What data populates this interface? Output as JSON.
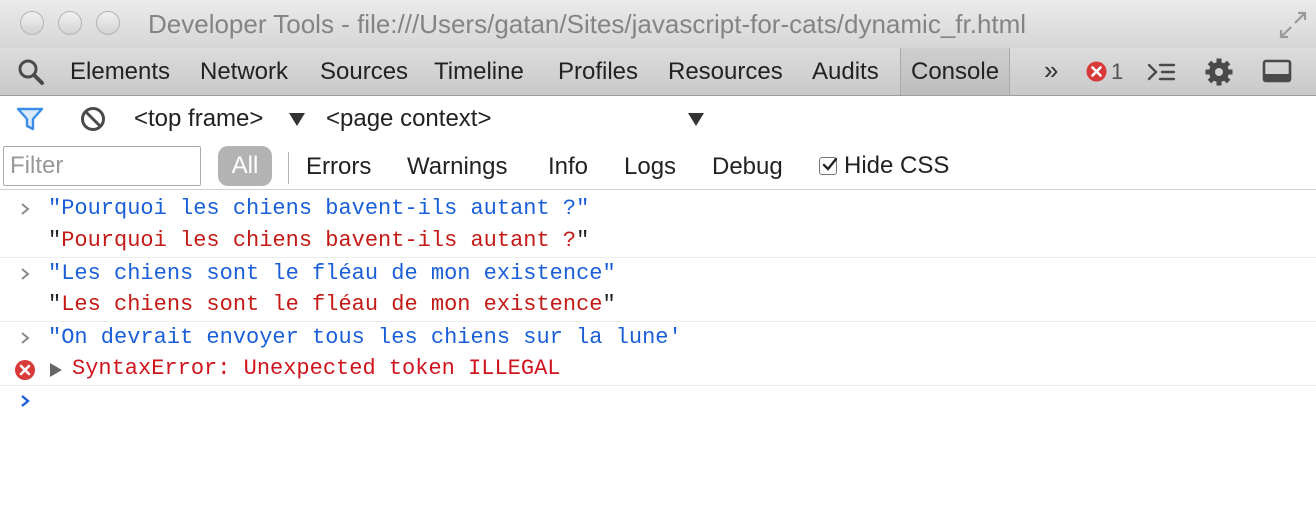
{
  "window": {
    "title": "Developer Tools - file:///Users/gatan/Sites/javascript-for-cats/dynamic_fr.html"
  },
  "tabs": [
    {
      "label": "Elements"
    },
    {
      "label": "Network"
    },
    {
      "label": "Sources"
    },
    {
      "label": "Timeline"
    },
    {
      "label": "Profiles"
    },
    {
      "label": "Resources"
    },
    {
      "label": "Audits"
    },
    {
      "label": "Console",
      "selected": true
    }
  ],
  "toolbar": {
    "overflow_label": "»",
    "error_count": "1"
  },
  "context": {
    "frame_label": "<top frame>",
    "page_context_label": "<page context>"
  },
  "filter": {
    "placeholder": "Filter",
    "all_label": "All",
    "levels": [
      "Errors",
      "Warnings",
      "Info",
      "Logs",
      "Debug"
    ],
    "hide_css_label": "Hide CSS",
    "hide_css_checked": true
  },
  "console": {
    "entries": [
      {
        "type": "command",
        "text": "\"Pourquoi les chiens bavent-ils autant ?\""
      },
      {
        "type": "result",
        "open_quote": "\"",
        "text": "Pourquoi les chiens bavent-ils autant ?",
        "close_quote": "\""
      },
      {
        "type": "command",
        "text": "\"Les chiens sont le fléau de mon existence\""
      },
      {
        "type": "result",
        "open_quote": "\"",
        "text": "Les chiens sont le fléau de mon existence",
        "close_quote": "\""
      },
      {
        "type": "command",
        "text": "\"On devrait envoyer tous les chiens sur la lune'"
      },
      {
        "type": "error",
        "text": "SyntaxError: Unexpected token ILLEGAL"
      }
    ]
  },
  "colors": {
    "command_text": "#1a5fd8",
    "result_text": "#c41a16",
    "error_text": "#d0141e",
    "error_icon": "#d83a3a",
    "filter_icon": "#3c8fe6"
  }
}
